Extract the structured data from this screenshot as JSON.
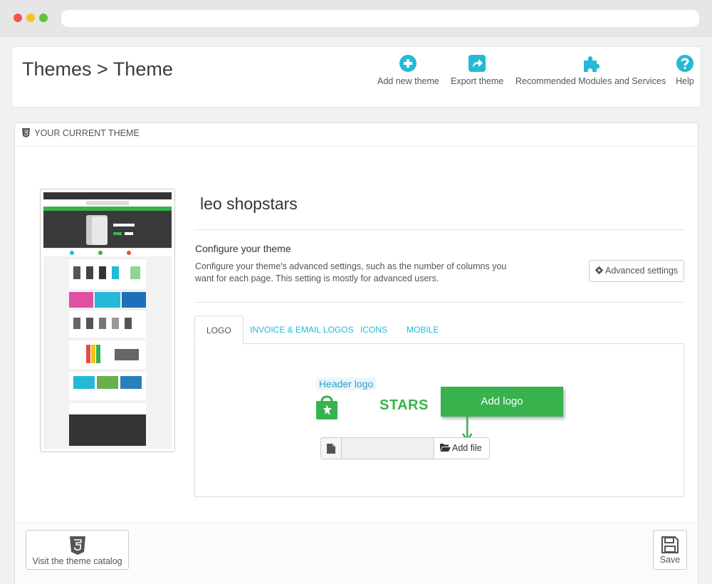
{
  "toolbar": {
    "title": "Themes > Theme",
    "buttons": [
      {
        "label": "Add new theme",
        "icon": "plus-circle-icon"
      },
      {
        "label": "Export theme",
        "icon": "export-share-icon"
      },
      {
        "label": "Recommended Modules and Services",
        "icon": "puzzle-icon"
      },
      {
        "label": "Help",
        "icon": "question-circle-icon"
      }
    ]
  },
  "panel": {
    "heading": "YOUR CURRENT THEME",
    "theme_name": "leo shopstars",
    "configure_title": "Configure your theme",
    "configure_desc": "Configure your theme's advanced settings, such as the number of columns you want for each page. This setting is mostly for advanced users.",
    "advanced_button": "Advanced settings",
    "tabs": [
      {
        "label": "LOGO",
        "active": true
      },
      {
        "label": "INVOICE & EMAIL LOGOS",
        "active": false
      },
      {
        "label": "ICONS",
        "active": false
      },
      {
        "label": "MOBILE",
        "active": false
      }
    ],
    "logo_tab": {
      "header_logo_label": "Header logo",
      "logo_text": "STARS",
      "add_logo_callout": "Add logo",
      "add_file_button": "Add file",
      "file_value": ""
    }
  },
  "footer": {
    "catalog_button": "Visit the theme catalog",
    "save_button": "Save"
  },
  "colors": {
    "accent": "#25b9d7",
    "brand_green": "#37b24d"
  }
}
